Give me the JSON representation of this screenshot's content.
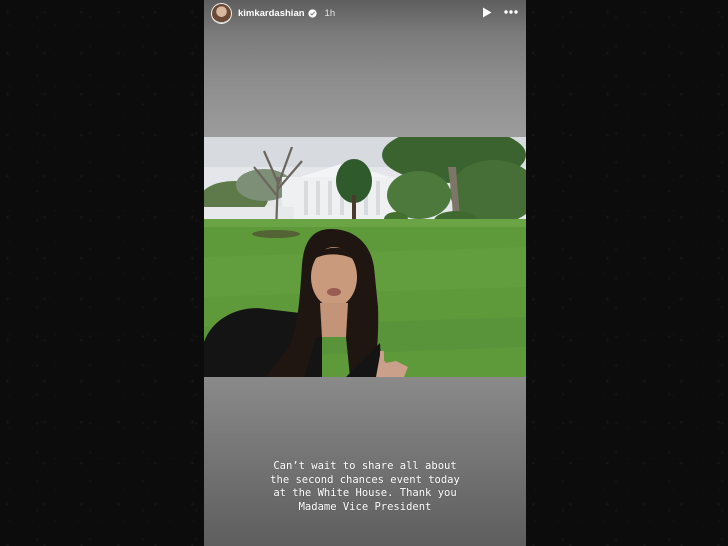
{
  "story": {
    "username": "kimkardashian",
    "timestamp": "1h",
    "caption": "Can’t wait to share all about\nthe second chances event today\nat the White House. Thank you\nMadame Vice President"
  },
  "icons": {
    "avatar": "profile-avatar",
    "verified": "verified-badge-icon",
    "play": "play-icon",
    "more": "more-options-icon"
  },
  "colors": {
    "page_background": "#0b0b0b",
    "story_background": "#a2a2a2",
    "text": "#ffffff",
    "lawn": "#5f9a3a",
    "sky": "#e4e6ea"
  }
}
